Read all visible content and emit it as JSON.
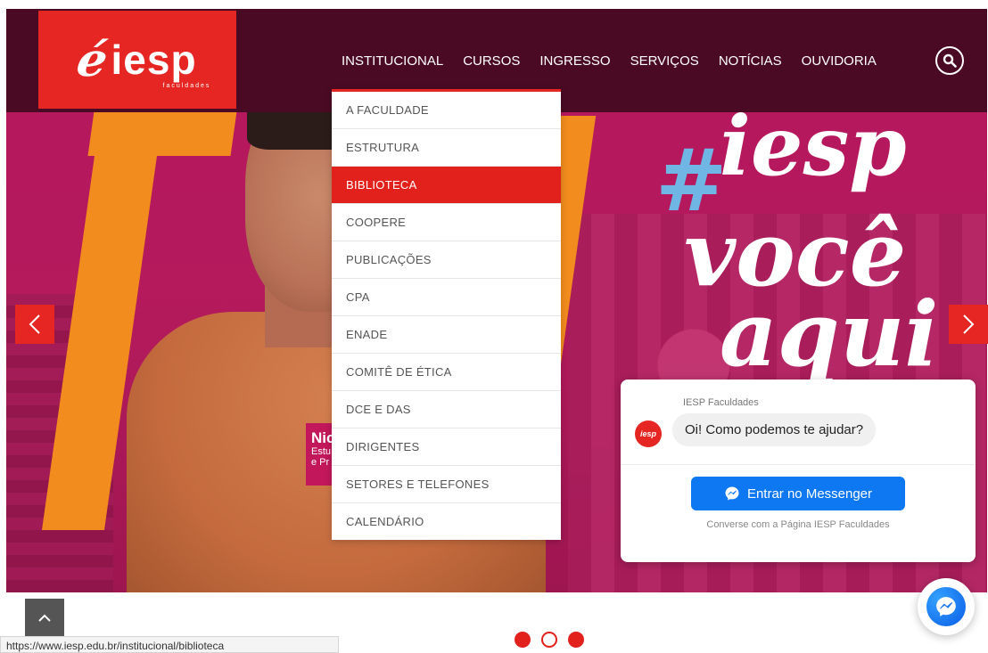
{
  "logo": {
    "text": "iesp",
    "mark": "é",
    "sub": "faculdades"
  },
  "nav": {
    "items": [
      "INSTITUCIONAL",
      "CURSOS",
      "INGRESSO",
      "SERVIÇOS",
      "NOTÍCIAS",
      "OUVIDORIA"
    ]
  },
  "dropdown": {
    "items": [
      "A FACULDADE",
      "ESTRUTURA",
      "BIBLIOTECA",
      "COOPERE",
      "PUBLICAÇÕES",
      "CPA",
      "ENADE",
      "COMITÊ DE ÉTICA",
      "DCE E DAS",
      "DIRIGENTES",
      "SETORES E TELEFONES",
      "CALENDÁRIO"
    ],
    "active": "BIBLIOTECA"
  },
  "hero": {
    "slogan_hash": "#",
    "slogan_word1": "iesp",
    "slogan_word2": "você",
    "slogan_word3": "aqui",
    "name_tag_name": "Nic",
    "name_tag_sub1": "Estu",
    "name_tag_sub2": "e Pr"
  },
  "messenger": {
    "page_name": "IESP Faculdades",
    "avatar_text": "iesp",
    "greeting": "Oi! Como podemos te ajudar?",
    "button_label": "Entrar no Messenger",
    "note": "Converse com a Página IESP Faculdades"
  },
  "status_bar": {
    "url": "https://www.iesp.edu.br/institucional/biblioteca"
  },
  "colors": {
    "brand_red": "#e52623",
    "header_bg": "#4a0a23",
    "messenger_blue": "#0d78f2"
  },
  "icons": {
    "search": "search-icon",
    "prev": "chevron-left-icon",
    "next": "chevron-right-icon",
    "top": "chevron-up-icon",
    "messenger": "messenger-icon"
  }
}
